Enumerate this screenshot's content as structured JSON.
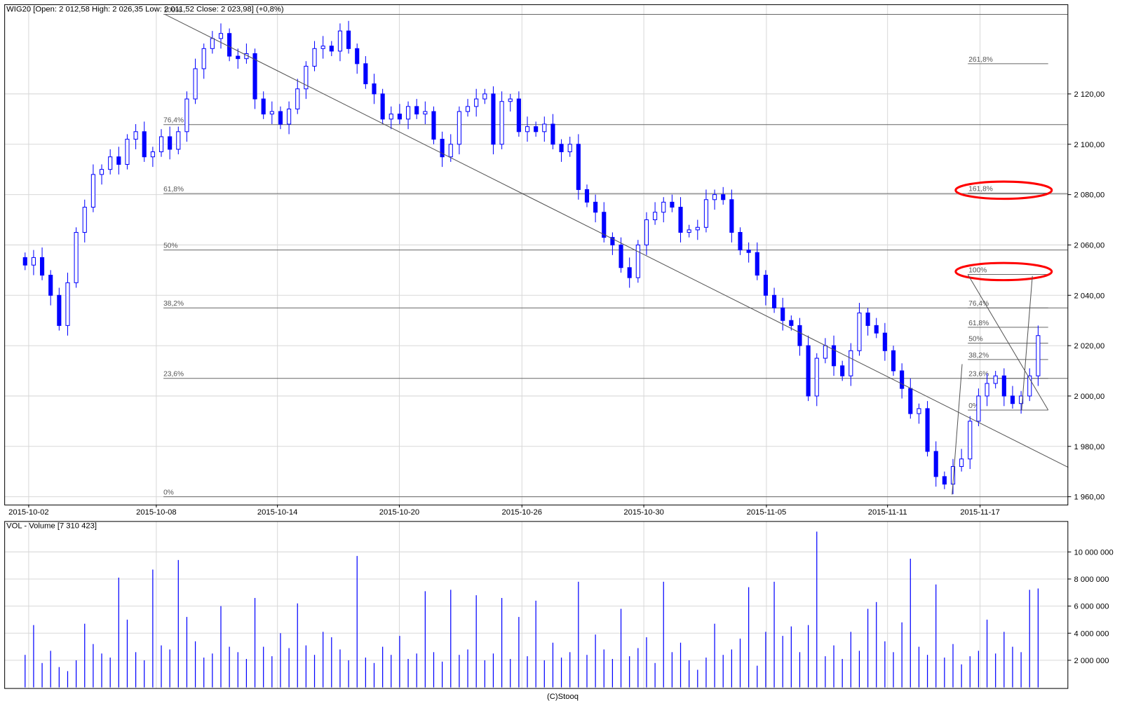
{
  "header": {
    "title": "WIG20 [Open: 2 012,58  High: 2 026,35  Low: 2 011,52  Close: 2 023,98] (+0,8%)"
  },
  "volume_header": {
    "title": "VOL - Volume [7 310 423]"
  },
  "footer": {
    "copyright": "(C)Stooq"
  },
  "colors": {
    "candle": "#0000ff",
    "grid": "#d8d8d8",
    "fib_line": "#666666",
    "highlight": "#ff0000"
  },
  "chart_data": [
    {
      "type": "candlestick",
      "series_name": "WIG20",
      "y_ticks": [
        "1 960,00",
        "1 980,00",
        "2 000,00",
        "2 020,00",
        "2 040,00",
        "2 060,00",
        "2 080,00",
        "2 100,00",
        "2 120,00"
      ],
      "y_tick_values": [
        1960,
        1980,
        2000,
        2020,
        2040,
        2060,
        2080,
        2100,
        2120
      ],
      "ylim": [
        1956,
        2153
      ],
      "x_ticks": [
        "2015-10-02",
        "2015-10-08",
        "2015-10-14",
        "2015-10-20",
        "2015-10-26",
        "2015-10-30",
        "2015-11-05",
        "2015-11-11",
        "2015-11-17"
      ],
      "grid": true,
      "closes": [
        2052,
        2055,
        2048,
        2040,
        2028,
        2045,
        2065,
        2075,
        2088,
        2090,
        2095,
        2092,
        2102,
        2105,
        2095,
        2097,
        2103,
        2098,
        2105,
        2118,
        2130,
        2138,
        2142,
        2144,
        2135,
        2134,
        2136,
        2118,
        2112,
        2113,
        2108,
        2114,
        2122,
        2131,
        2138,
        2139,
        2137,
        2145,
        2138,
        2132,
        2124,
        2120,
        2110,
        2112,
        2110,
        2115,
        2112,
        2113,
        2102,
        2095,
        2100,
        2113,
        2115,
        2118,
        2120,
        2100,
        2117,
        2118,
        2105,
        2107,
        2105,
        2108,
        2100,
        2097,
        2100,
        2082,
        2077,
        2073,
        2063,
        2060,
        2051,
        2047,
        2060,
        2070,
        2073,
        2077,
        2075,
        2065,
        2066,
        2067,
        2078,
        2080,
        2078,
        2065,
        2058,
        2057,
        2048,
        2040,
        2035,
        2030,
        2028,
        2020,
        2000,
        2015,
        2020,
        2012,
        2008,
        2018,
        2033,
        2028,
        2025,
        2018,
        2010,
        2003,
        1993,
        1995,
        1978,
        1968,
        1965,
        1972,
        1975,
        1990,
        2000,
        2005,
        2008,
        2000,
        1997,
        2000,
        2008,
        2024
      ],
      "fibonacci_left": [
        {
          "label": "100%",
          "value": 2151.6
        },
        {
          "label": "76,4%",
          "value": 2107.8
        },
        {
          "label": "61,8%",
          "value": 2080.4
        },
        {
          "label": "50%",
          "value": 2058.0
        },
        {
          "label": "38,2%",
          "value": 2035.0
        },
        {
          "label": "23,6%",
          "value": 2007.0
        },
        {
          "label": "0%",
          "value": 1960.0
        }
      ],
      "fibonacci_right": [
        {
          "label": "261,8%",
          "value": 2132.0
        },
        {
          "label": "161,8%",
          "value": 2080.6,
          "highlighted": true
        },
        {
          "label": "100%",
          "value": 2048.3,
          "highlighted": true
        },
        {
          "label": "76,4%",
          "value": 2035.0
        },
        {
          "label": "61,8%",
          "value": 2027.3
        },
        {
          "label": "50%",
          "value": 2021.0
        },
        {
          "label": "38,2%",
          "value": 2014.5
        },
        {
          "label": "23,6%",
          "value": 2007.0
        },
        {
          "label": "0%",
          "value": 1994.4
        }
      ]
    },
    {
      "type": "bar",
      "series_name": "VOL - Volume",
      "y_ticks": [
        "2 000 000",
        "4 000 000",
        "6 000 000",
        "8 000 000",
        "10 000 000"
      ],
      "y_tick_values": [
        2,
        4,
        6,
        8,
        10
      ],
      "unit": "millions",
      "ylim": [
        0,
        12
      ],
      "grid": true,
      "values": [
        2.4,
        4.6,
        1.8,
        2.7,
        1.5,
        1.2,
        2.0,
        4.7,
        3.2,
        2.5,
        2.2,
        8.1,
        5.0,
        2.6,
        2.0,
        8.7,
        3.1,
        2.8,
        9.4,
        5.2,
        3.4,
        2.2,
        2.5,
        6.0,
        3.0,
        2.6,
        2.1,
        6.6,
        3.0,
        2.3,
        4.0,
        2.9,
        6.2,
        3.1,
        2.4,
        4.1,
        3.7,
        2.8,
        2.0,
        9.7,
        2.2,
        1.8,
        3.0,
        2.4,
        3.8,
        2.1,
        2.5,
        7.1,
        2.6,
        1.9,
        7.2,
        2.4,
        2.8,
        6.8,
        2.0,
        2.5,
        6.6,
        2.1,
        5.2,
        2.3,
        6.4,
        2.0,
        3.3,
        2.2,
        2.6,
        7.8,
        2.4,
        3.9,
        2.8,
        2.1,
        5.8,
        2.3,
        2.9,
        3.7,
        1.8,
        7.8,
        2.6,
        3.3,
        2.0,
        1.3,
        2.2,
        4.7,
        2.4,
        2.8,
        3.6,
        7.4,
        1.6,
        4.1,
        7.8,
        3.8,
        4.5,
        2.6,
        4.6,
        11.5,
        2.3,
        3.1,
        2.1,
        4.1,
        2.7,
        5.8,
        6.3,
        3.4,
        2.6,
        4.8,
        9.5,
        3.0,
        2.4,
        7.6,
        2.2,
        3.2,
        1.7,
        2.3,
        2.7,
        5.0,
        2.5,
        4.1,
        3.0,
        2.6,
        7.2,
        7.3
      ]
    }
  ]
}
